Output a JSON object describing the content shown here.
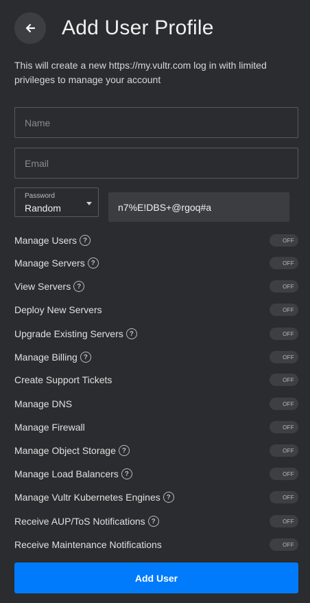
{
  "header": {
    "title": "Add User Profile",
    "back_icon": "arrow-left-icon"
  },
  "description": "This will create a new https://my.vultr.com log in with limited privileges to manage your account",
  "form": {
    "name_placeholder": "Name",
    "email_placeholder": "Email",
    "password_label": "Password",
    "password_mode": "Random",
    "password_value": "n7%E!DBS+@rgoq#a"
  },
  "permissions": [
    {
      "label": "Manage Users",
      "help": true,
      "state": "OFF"
    },
    {
      "label": "Manage Servers",
      "help": true,
      "state": "OFF"
    },
    {
      "label": "View Servers",
      "help": true,
      "state": "OFF"
    },
    {
      "label": "Deploy New Servers",
      "help": false,
      "state": "OFF"
    },
    {
      "label": "Upgrade Existing Servers",
      "help": true,
      "state": "OFF"
    },
    {
      "label": "Manage Billing",
      "help": true,
      "state": "OFF"
    },
    {
      "label": "Create Support Tickets",
      "help": false,
      "state": "OFF"
    },
    {
      "label": "Manage DNS",
      "help": false,
      "state": "OFF"
    },
    {
      "label": "Manage Firewall",
      "help": false,
      "state": "OFF"
    },
    {
      "label": "Manage Object Storage",
      "help": true,
      "state": "OFF"
    },
    {
      "label": "Manage Load Balancers",
      "help": true,
      "state": "OFF"
    },
    {
      "label": "Manage Vultr Kubernetes Engines",
      "help": true,
      "state": "OFF"
    },
    {
      "label": "Receive AUP/ToS Notifications",
      "help": true,
      "state": "OFF"
    },
    {
      "label": "Receive Maintenance Notifications",
      "help": false,
      "state": "OFF"
    }
  ],
  "submit_label": "Add User",
  "colors": {
    "background": "#2b2c2f",
    "accent": "#007bfc"
  }
}
